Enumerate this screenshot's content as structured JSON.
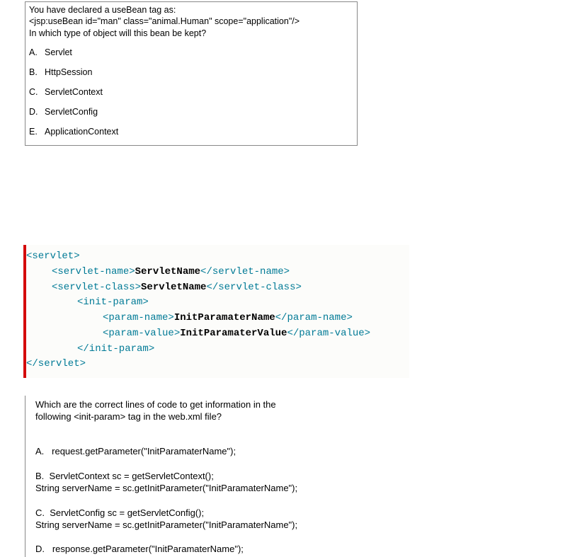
{
  "q1": {
    "line1": "You have declared a useBean tag as:",
    "line2": "<jsp:useBean id=\"man\" class=\"animal.Human\" scope=\"application\"/>",
    "line3": "In which type of object will this bean be kept?",
    "options": [
      {
        "letter": "A.",
        "text": "Servlet"
      },
      {
        "letter": "B.",
        "text": "HttpSession"
      },
      {
        "letter": "C.",
        "text": "ServletContext"
      },
      {
        "letter": "D.",
        "text": "ServletConfig"
      },
      {
        "letter": "E.",
        "text": "ApplicationContext"
      }
    ]
  },
  "code": {
    "l0_open": "<servlet>",
    "l1_open": "<servlet-name>",
    "l1_val": "ServletName",
    "l1_close": "</servlet-name>",
    "l2_open": "<servlet-class>",
    "l2_val": "ServletName",
    "l2_close": "</servlet-class>",
    "l3_open": "<init-param>",
    "l4_open": "<param-name>",
    "l4_val": "InitParamaterName",
    "l4_close": "</param-name>",
    "l5_open": "<param-value>",
    "l5_val": "InitParamaterValue",
    "l5_close": "</param-value>",
    "l6_close": "</init-param>",
    "l7_close": "</servlet>"
  },
  "q2": {
    "line1": "Which are the correct lines of code to get information in the",
    "line2_a": "following   ",
    "line2_tag": "<init-param>",
    "line2_b": " tag in the web.xml file?",
    "options": {
      "a": {
        "letter": "A.",
        "text": "request.getParameter(\"InitParamaterName\");"
      },
      "b": {
        "letter": "B.",
        "l1": "ServletContext sc = getServletContext();",
        "l2": "String serverName =  sc.getInitParameter(\"InitParamaterName\");"
      },
      "c": {
        "letter": "C.",
        "l1": "ServletConfig sc = getServletConfig();",
        "l2": "String serverName =  sc.getInitParameter(\"InitParamaterName\");"
      },
      "d": {
        "letter": "D.",
        "text": "response.getParameter(\"InitParamaterName\");"
      }
    }
  }
}
